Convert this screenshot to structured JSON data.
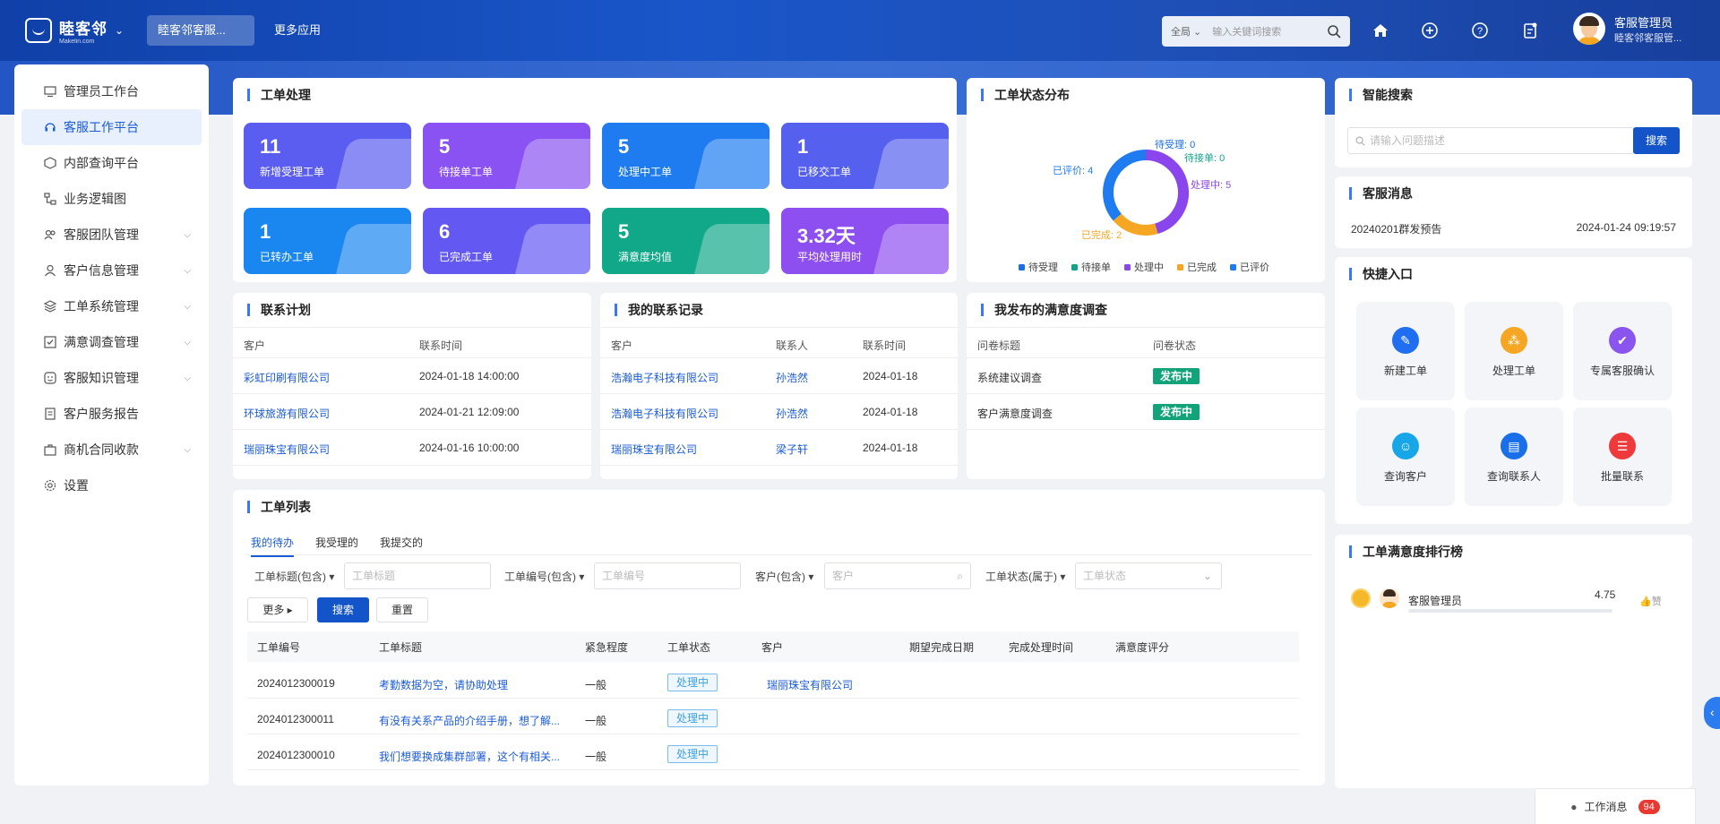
{
  "header": {
    "logo_text": "睦客邻",
    "logo_sub": "Makelin.com",
    "app_tab_active": "睦客邻客服...",
    "app_tab_more": "更多应用",
    "search_scope": "全局",
    "search_placeholder": "输入关键词搜索",
    "user_name": "客服管理员",
    "user_org": "睦客邻客服管..."
  },
  "sidebar": {
    "items": [
      {
        "label": "管理员工作台",
        "icon": "monitor-icon"
      },
      {
        "label": "客服工作平台",
        "icon": "headset-icon"
      },
      {
        "label": "内部查询平台",
        "icon": "cube-icon"
      },
      {
        "label": "业务逻辑图",
        "icon": "flow-icon"
      },
      {
        "label": "客服团队管理",
        "icon": "team-icon"
      },
      {
        "label": "客户信息管理",
        "icon": "user-icon"
      },
      {
        "label": "工单系统管理",
        "icon": "layers-icon"
      },
      {
        "label": "满意调查管理",
        "icon": "checkbox-icon"
      },
      {
        "label": "客服知识管理",
        "icon": "smile-icon"
      },
      {
        "label": "客户服务报告",
        "icon": "report-icon"
      },
      {
        "label": "商机合同收款",
        "icon": "briefcase-icon"
      },
      {
        "label": "设置",
        "icon": "gear-icon"
      }
    ]
  },
  "workorder": {
    "title": "工单处理",
    "stats": [
      {
        "num": "11",
        "label": "新增受理工单",
        "color": "#5b5cf0"
      },
      {
        "num": "5",
        "label": "待接单工单",
        "color": "#8a52f2"
      },
      {
        "num": "5",
        "label": "处理中工单",
        "color": "#1e7cf0"
      },
      {
        "num": "1",
        "label": "已移交工单",
        "color": "#5560ef"
      },
      {
        "num": "1",
        "label": "已转办工单",
        "color": "#1a86f0"
      },
      {
        "num": "6",
        "label": "已完成工单",
        "color": "#6458f2"
      },
      {
        "num": "5",
        "label": "满意度均值",
        "color": "#10a888"
      },
      {
        "num": "3.32天",
        "label": "平均处理用时",
        "color": "#8e4ff0"
      }
    ]
  },
  "status_dist": {
    "title": "工单状态分布",
    "labels": {
      "accepted": "待受理: 0",
      "pending": "待接单: 0",
      "processing": "处理中: 5",
      "done": "已完成: 2",
      "rated": "已评价: 4"
    },
    "legend": [
      {
        "name": "待受理",
        "color": "#1a6ee8"
      },
      {
        "name": "待接单",
        "color": "#14a38a"
      },
      {
        "name": "处理中",
        "color": "#8a45ec"
      },
      {
        "name": "已完成",
        "color": "#f5a623"
      },
      {
        "name": "已评价",
        "color": "#1f7cf0"
      }
    ]
  },
  "chart_data": {
    "type": "pie",
    "categories": [
      "待受理",
      "待接单",
      "处理中",
      "已完成",
      "已评价"
    ],
    "values": [
      0,
      0,
      5,
      2,
      4
    ]
  },
  "smart_search": {
    "title": "智能搜索",
    "placeholder": "请输入问题描述",
    "button": "搜索"
  },
  "messages": {
    "title": "客服消息",
    "item": "20240201群发预告",
    "time": "2024-01-24 09:19:57"
  },
  "quick": {
    "title": "快捷入口",
    "items": [
      {
        "label": "新建工单",
        "color": "#1f6ff0",
        "icon": "edit-icon"
      },
      {
        "label": "处理工单",
        "color": "#f5a623",
        "icon": "nodes-icon"
      },
      {
        "label": "专属客服确认",
        "color": "#8a55ee",
        "icon": "user-check-icon"
      },
      {
        "label": "查询客户",
        "color": "#17a6e8",
        "icon": "user-icon"
      },
      {
        "label": "查询联系人",
        "color": "#1a6ee8",
        "icon": "contact-icon"
      },
      {
        "label": "批量联系",
        "color": "#ee3a3a",
        "icon": "batch-icon"
      }
    ]
  },
  "ranking": {
    "title": "工单满意度排行榜",
    "name": "客服管理员",
    "score": "4.75",
    "like": "赞"
  },
  "contact_plan": {
    "title": "联系计划",
    "headers": [
      "客户",
      "联系时间"
    ],
    "rows": [
      [
        "彩虹印刷有限公司",
        "2024-01-18 14:00:00"
      ],
      [
        "环球旅游有限公司",
        "2024-01-21 12:09:00"
      ],
      [
        "瑞丽珠宝有限公司",
        "2024-01-16 10:00:00"
      ]
    ]
  },
  "my_contacts": {
    "title": "我的联系记录",
    "headers": [
      "客户",
      "联系人",
      "联系时间"
    ],
    "rows": [
      [
        "浩瀚电子科技有限公司",
        "孙浩然",
        "2024-01-18"
      ],
      [
        "浩瀚电子科技有限公司",
        "孙浩然",
        "2024-01-18"
      ],
      [
        "瑞丽珠宝有限公司",
        "梁子轩",
        "2024-01-18"
      ]
    ]
  },
  "surveys": {
    "title": "我发布的满意度调查",
    "headers": [
      "问卷标题",
      "问卷状态"
    ],
    "rows": [
      [
        "系统建议调查",
        "发布中"
      ],
      [
        "客户满意度调查",
        "发布中"
      ]
    ]
  },
  "order_list": {
    "title": "工单列表",
    "tabs": [
      "我的待办",
      "我受理的",
      "我提交的"
    ],
    "filters": [
      {
        "label": "工单标题(包含)",
        "placeholder": "工单标题"
      },
      {
        "label": "工单编号(包含)",
        "placeholder": "工单编号"
      },
      {
        "label": "客户(包含)",
        "placeholder": "客户"
      },
      {
        "label": "工单状态(属于)",
        "placeholder": "工单状态"
      }
    ],
    "more_label": "更多",
    "search_label": "搜索",
    "reset_label": "重置",
    "headers": [
      "工单编号",
      "工单标题",
      "紧急程度",
      "工单状态",
      "客户",
      "期望完成日期",
      "完成处理时间",
      "满意度评分"
    ],
    "rows": [
      [
        "2024012300019",
        "考勤数据为空，请协助处理",
        "一般",
        "处理中",
        "瑞丽珠宝有限公司"
      ],
      [
        "2024012300011",
        "有没有关系产品的介绍手册，想了解...",
        "一般",
        "处理中",
        ""
      ],
      [
        "2024012300010",
        "我们想要换成集群部署，这个有相关...",
        "一般",
        "处理中",
        ""
      ]
    ]
  },
  "footer": {
    "work_msg": "工作消息",
    "badge": "94"
  }
}
